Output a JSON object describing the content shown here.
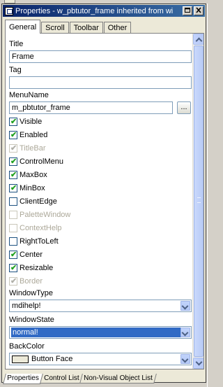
{
  "window": {
    "title": "Properties - w_pbtutor_frame  inherited  from  wi"
  },
  "tabs": [
    {
      "label": "General"
    },
    {
      "label": "Scroll"
    },
    {
      "label": "Toolbar"
    },
    {
      "label": "Other"
    }
  ],
  "labels": {
    "title": "Title",
    "tag": "Tag",
    "menuname": "MenuName",
    "windowtype": "WindowType",
    "windowstate": "WindowState",
    "backcolor": "BackColor"
  },
  "fields": {
    "title": "Frame",
    "tag": "",
    "menuname": "m_pbtutor_frame",
    "ellipsis": "..."
  },
  "checkboxes": [
    {
      "label": "Visible"
    },
    {
      "label": "Enabled"
    },
    {
      "label": "TitleBar"
    },
    {
      "label": "ControlMenu"
    },
    {
      "label": "MaxBox"
    },
    {
      "label": "MinBox"
    },
    {
      "label": "ClientEdge"
    },
    {
      "label": "PaletteWindow"
    },
    {
      "label": "ContextHelp"
    },
    {
      "label": "RightToLeft"
    },
    {
      "label": "Center"
    },
    {
      "label": "Resizable"
    },
    {
      "label": "Border"
    }
  ],
  "dropdowns": {
    "windowtype": "mdihelp!",
    "windowstate": "normal!",
    "backcolor": "Button Face"
  },
  "bottom_tabs": [
    {
      "label": "Properties"
    },
    {
      "label": "Control List"
    },
    {
      "label": "Non-Visual Object List"
    }
  ],
  "colors": {
    "titlebar_start": "#0a246a",
    "titlebar_end": "#3a6ea5",
    "selection": "#316ac5",
    "check_green": "#21a121"
  }
}
